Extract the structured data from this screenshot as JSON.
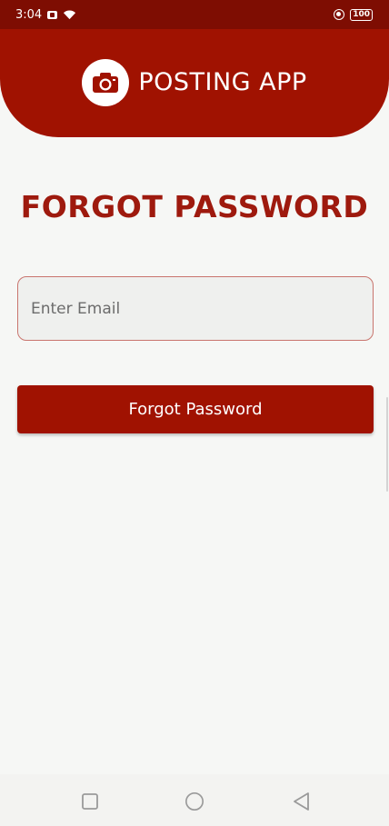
{
  "status_bar": {
    "time": "3:04",
    "battery": "100"
  },
  "header": {
    "title": "POSTING APP",
    "logo_icon": "camera-icon"
  },
  "page": {
    "title": "FORGOT PASSWORD"
  },
  "form": {
    "email_placeholder": "Enter Email",
    "email_value": "",
    "submit_label": "Forgot Password"
  },
  "nav": {
    "recents_icon": "square-icon",
    "home_icon": "circle-icon",
    "back_icon": "triangle-back-icon"
  },
  "colors": {
    "header": "#a01201",
    "status_bar": "#7e0d02",
    "title": "#9e1a0e",
    "background": "#f6f7f5"
  }
}
